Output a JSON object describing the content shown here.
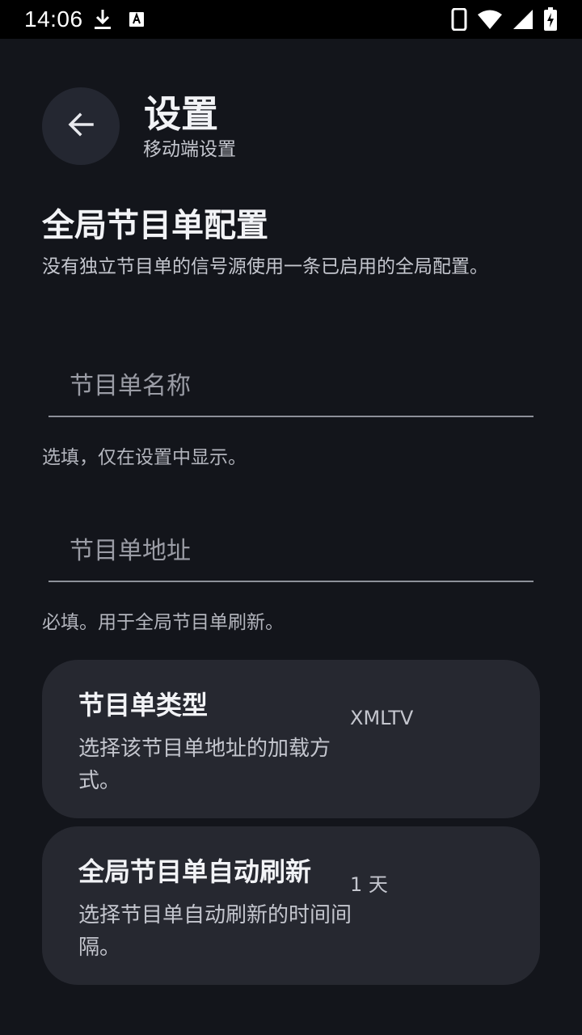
{
  "status_bar": {
    "time": "14:06"
  },
  "header": {
    "title": "设置",
    "subtitle": "移动端设置"
  },
  "section": {
    "title": "全局节目单配置",
    "description": "没有独立节目单的信号源使用一条已启用的全局配置。"
  },
  "fields": {
    "epg_name": {
      "value": "",
      "placeholder": "节目单名称",
      "helper": "选填，仅在设置中显示。"
    },
    "epg_url": {
      "value": "",
      "placeholder": "节目单地址",
      "helper": "必填。用于全局节目单刷新。"
    }
  },
  "cards": {
    "epg_type": {
      "title": "节目单类型",
      "description": "选择该节目单地址的加载方式。",
      "value": "XMLTV"
    },
    "auto_refresh": {
      "title": "全局节目单自动刷新",
      "description": "选择节目单自动刷新的时间间隔。",
      "value": "1 天"
    }
  },
  "icons": {
    "status_left": [
      "download-icon",
      "font-icon"
    ],
    "status_right": [
      "phone-icon",
      "wifi-icon",
      "signal-icon",
      "battery-charging-icon"
    ],
    "back": "arrow-left-icon"
  },
  "colors": {
    "background": "#13151b",
    "card": "#262830",
    "back_button": "#242731"
  }
}
